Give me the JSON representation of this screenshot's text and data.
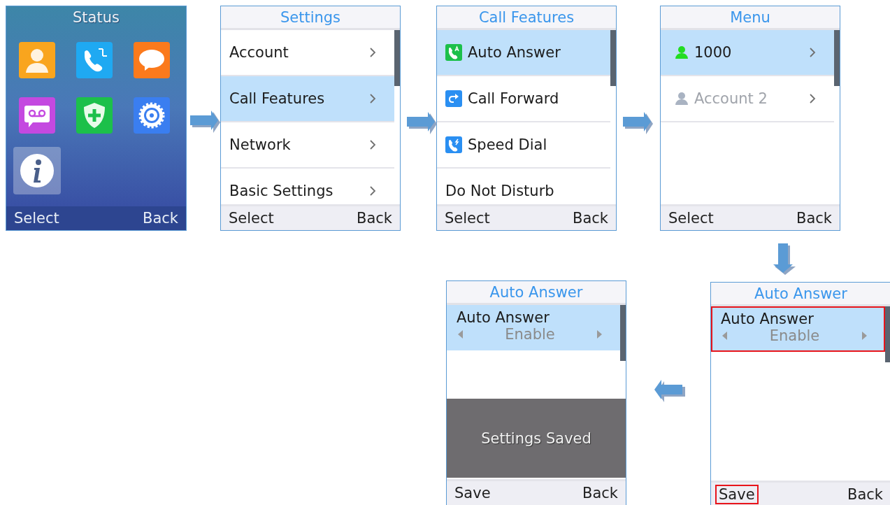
{
  "screens": [
    {
      "kind": "home",
      "title": "Status",
      "tiles": [
        {
          "selected": false
        },
        {
          "selected": false
        },
        {
          "selected": false
        },
        {
          "selected": false
        },
        {
          "selected": false
        },
        {
          "selected": false
        },
        {
          "selected": true
        }
      ],
      "softkeys": {
        "left": "Select",
        "right": "Back"
      }
    },
    {
      "kind": "list",
      "title": "Settings",
      "items": [
        {
          "kind": "plain",
          "label": "Account",
          "selected": false,
          "chevron": true
        },
        {
          "kind": "plain",
          "label": "Call Features",
          "selected": true,
          "chevron": true
        },
        {
          "kind": "plain",
          "label": "Network",
          "selected": false,
          "chevron": true
        },
        {
          "kind": "plain",
          "label": "Basic Settings",
          "selected": false,
          "chevron": true
        }
      ],
      "softkeys": {
        "left": "Select",
        "right": "Back"
      }
    },
    {
      "kind": "list",
      "title": "Call Features",
      "items": [
        {
          "kind": "feature",
          "label": "Auto Answer",
          "selected": true,
          "chevron": false
        },
        {
          "kind": "feature",
          "label": "Call Forward",
          "selected": false,
          "chevron": false
        },
        {
          "kind": "feature",
          "label": "Speed Dial",
          "selected": false,
          "chevron": false
        },
        {
          "kind": "plain",
          "label": "Do Not Disturb",
          "selected": false,
          "chevron": false
        }
      ],
      "softkeys": {
        "left": "Select",
        "right": "Back"
      }
    },
    {
      "kind": "list",
      "title": "Menu",
      "items": [
        {
          "kind": "account",
          "label": "1000",
          "selected": true,
          "disabled": false,
          "chevron": true,
          "color": "#22dd22"
        },
        {
          "kind": "account",
          "label": "Account 2",
          "selected": false,
          "disabled": true,
          "chevron": true,
          "color": "#a9b3c2"
        }
      ],
      "softkeys": {
        "left": "Select",
        "right": "Back"
      }
    },
    {
      "kind": "setting",
      "title": "Auto Answer",
      "items": [
        {
          "label": "Auto Answer",
          "value": "Enable",
          "selected": true,
          "highlighted": false
        }
      ],
      "toast": "Settings Saved",
      "softkeys": {
        "left": "Save",
        "left_highlighted": false,
        "right": "Back"
      }
    },
    {
      "kind": "setting",
      "title": "Auto Answer",
      "items": [
        {
          "label": "Auto Answer",
          "value": "Enable",
          "selected": true,
          "highlighted": true
        }
      ],
      "softkeys": {
        "left": "Save",
        "left_highlighted": true,
        "right": "Back"
      }
    }
  ],
  "arrows": [
    {
      "kind": "right"
    },
    {
      "kind": "right"
    },
    {
      "kind": "right"
    },
    {
      "kind": "down"
    },
    {
      "kind": "left"
    }
  ]
}
